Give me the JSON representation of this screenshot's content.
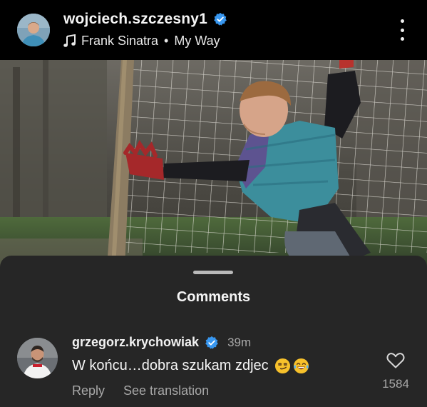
{
  "header": {
    "username": "wojciech.szczesny1",
    "verified": true,
    "audio": {
      "artist": "Frank Sinatra",
      "separator": "•",
      "track": "My Way"
    },
    "more_icon": "more-vertical-icon"
  },
  "post": {
    "image": "child-goalkeeper-diving-in-front-of-net"
  },
  "comments_sheet": {
    "title": "Comments",
    "comments": [
      {
        "username": "grzegorz.krychowiak",
        "verified": true,
        "time": "39m",
        "text": "W końcu…dobra szukam zdjec",
        "emojis": [
          "smirking-face-emoji",
          "tears-of-joy-emoji"
        ],
        "reply_label": "Reply",
        "translate_label": "See translation",
        "like_count": "1584",
        "like_icon": "heart-outline-icon"
      }
    ]
  },
  "colors": {
    "background": "#000000",
    "sheet": "#262626",
    "verified_badge": "#3897f0",
    "secondary_text": "#a8a8a8"
  }
}
